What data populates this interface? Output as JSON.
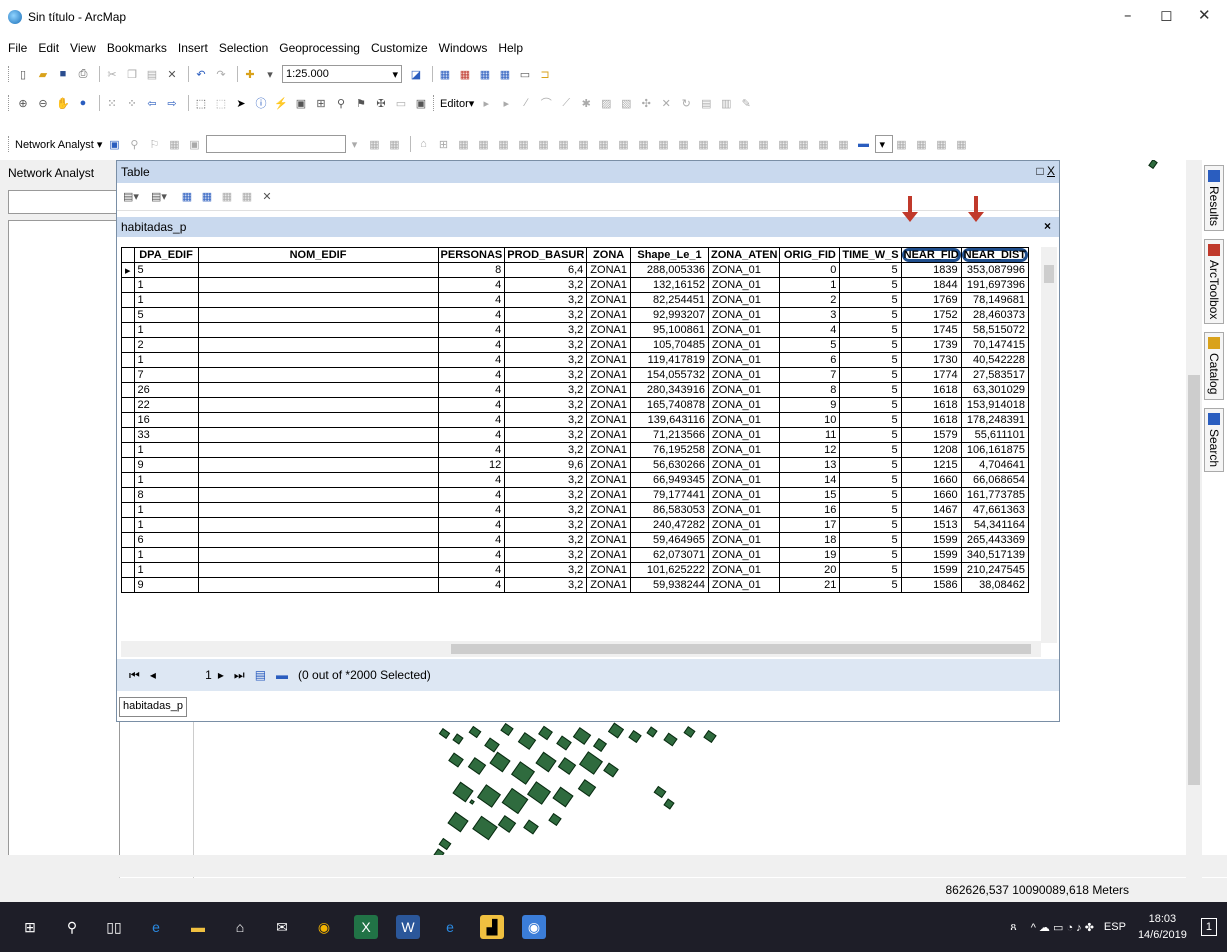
{
  "window": {
    "title": "Sin título - ArcMap",
    "icon": "arcmap-globe-icon"
  },
  "menu": [
    "File",
    "Edit",
    "View",
    "Bookmarks",
    "Insert",
    "Selection",
    "Geoprocessing",
    "Customize",
    "Windows",
    "Help"
  ],
  "toolbar": {
    "scale": "1:25.000",
    "editor_label": "Editor▾",
    "network_analyst_label": "Network Analyst ▾"
  },
  "left_panel": {
    "title": "Network Analyst"
  },
  "table_window": {
    "title": "Table",
    "layer_tab": "habitadas_p",
    "columns": [
      "DPA_EDIF",
      "NOM_EDIF",
      "PERSONAS",
      "PROD_BASUR",
      "ZONA",
      "Shape_Le_1",
      "ZONA_ATEN",
      "ORIG_FID",
      "TIME_W_S",
      "NEAR_FID",
      "NEAR_DIST"
    ],
    "rows": [
      [
        "5",
        "",
        "8",
        "6,4",
        "ZONA1",
        "288,005336",
        "ZONA_01",
        "0",
        "5",
        "1839",
        "353,087996"
      ],
      [
        "1",
        "",
        "4",
        "3,2",
        "ZONA1",
        "132,16152",
        "ZONA_01",
        "1",
        "5",
        "1844",
        "191,697396"
      ],
      [
        "1",
        "",
        "4",
        "3,2",
        "ZONA1",
        "82,254451",
        "ZONA_01",
        "2",
        "5",
        "1769",
        "78,149681"
      ],
      [
        "5",
        "",
        "4",
        "3,2",
        "ZONA1",
        "92,993207",
        "ZONA_01",
        "3",
        "5",
        "1752",
        "28,460373"
      ],
      [
        "1",
        "",
        "4",
        "3,2",
        "ZONA1",
        "95,100861",
        "ZONA_01",
        "4",
        "5",
        "1745",
        "58,515072"
      ],
      [
        "2",
        "",
        "4",
        "3,2",
        "ZONA1",
        "105,70485",
        "ZONA_01",
        "5",
        "5",
        "1739",
        "70,147415"
      ],
      [
        "1",
        "",
        "4",
        "3,2",
        "ZONA1",
        "119,417819",
        "ZONA_01",
        "6",
        "5",
        "1730",
        "40,542228"
      ],
      [
        "7",
        "",
        "4",
        "3,2",
        "ZONA1",
        "154,055732",
        "ZONA_01",
        "7",
        "5",
        "1774",
        "27,583517"
      ],
      [
        "26",
        "",
        "4",
        "3,2",
        "ZONA1",
        "280,343916",
        "ZONA_01",
        "8",
        "5",
        "1618",
        "63,301029"
      ],
      [
        "22",
        "",
        "4",
        "3,2",
        "ZONA1",
        "165,740878",
        "ZONA_01",
        "9",
        "5",
        "1618",
        "153,914018"
      ],
      [
        "16",
        "",
        "4",
        "3,2",
        "ZONA1",
        "139,643116",
        "ZONA_01",
        "10",
        "5",
        "1618",
        "178,248391"
      ],
      [
        "33",
        "",
        "4",
        "3,2",
        "ZONA1",
        "71,213566",
        "ZONA_01",
        "11",
        "5",
        "1579",
        "55,611101"
      ],
      [
        "1",
        "",
        "4",
        "3,2",
        "ZONA1",
        "76,195258",
        "ZONA_01",
        "12",
        "5",
        "1208",
        "106,161875"
      ],
      [
        "9",
        "",
        "12",
        "9,6",
        "ZONA1",
        "56,630266",
        "ZONA_01",
        "13",
        "5",
        "1215",
        "4,704641"
      ],
      [
        "1",
        "",
        "4",
        "3,2",
        "ZONA1",
        "66,949345",
        "ZONA_01",
        "14",
        "5",
        "1660",
        "66,068654"
      ],
      [
        "8",
        "",
        "4",
        "3,2",
        "ZONA1",
        "79,177441",
        "ZONA_01",
        "15",
        "5",
        "1660",
        "161,773785"
      ],
      [
        "1",
        "",
        "4",
        "3,2",
        "ZONA1",
        "86,583053",
        "ZONA_01",
        "16",
        "5",
        "1467",
        "47,661363"
      ],
      [
        "1",
        "",
        "4",
        "3,2",
        "ZONA1",
        "240,47282",
        "ZONA_01",
        "17",
        "5",
        "1513",
        "54,341164"
      ],
      [
        "6",
        "",
        "4",
        "3,2",
        "ZONA1",
        "59,464965",
        "ZONA_01",
        "18",
        "5",
        "1599",
        "265,443369"
      ],
      [
        "1",
        "",
        "4",
        "3,2",
        "ZONA1",
        "62,073071",
        "ZONA_01",
        "19",
        "5",
        "1599",
        "340,517139"
      ],
      [
        "1",
        "",
        "4",
        "3,2",
        "ZONA1",
        "101,625222",
        "ZONA_01",
        "20",
        "5",
        "1599",
        "210,247545"
      ],
      [
        "9",
        "",
        "4",
        "3,2",
        "ZONA1",
        "59,938244",
        "ZONA_01",
        "21",
        "5",
        "1586",
        "38,08462"
      ]
    ],
    "nav": {
      "current_record": "1",
      "selection_text": "(0 out of *2000 Selected)"
    },
    "bottom_tab": "habitadas_p",
    "circled_columns": [
      "NEAR_FID",
      "NEAR_DIST"
    ],
    "annotation_color": "#c0392b",
    "circle_color": "#1f4e8c"
  },
  "side_tabs": [
    "Results",
    "ArcToolbox",
    "Catalog",
    "Search"
  ],
  "status": {
    "coords": "862626,537  10090089,618 Meters"
  },
  "taskbar": {
    "lang": "ESP",
    "time": "18:03",
    "date": "14/6/2019",
    "notifications": "1"
  }
}
